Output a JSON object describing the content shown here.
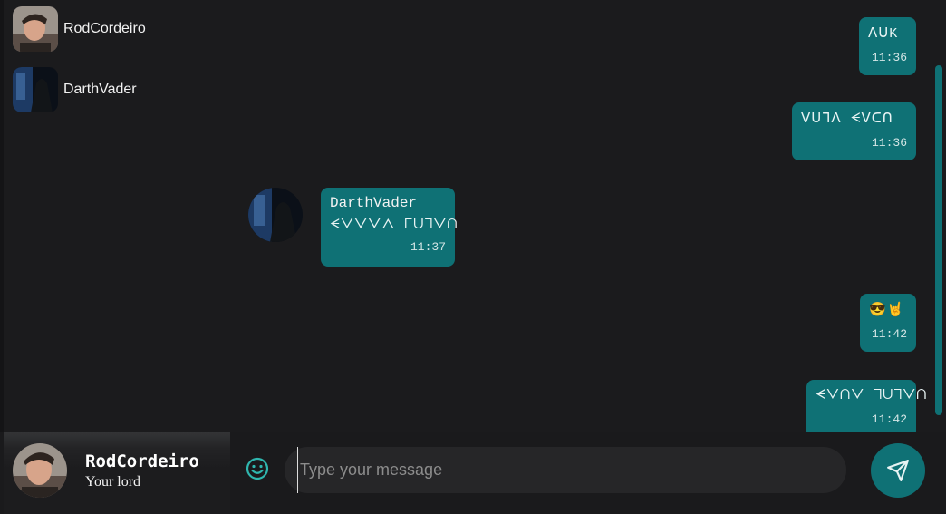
{
  "contacts": [
    {
      "name": "RodCordeiro"
    },
    {
      "name": "DarthVader"
    }
  ],
  "messages": [
    {
      "text": "ᐱᑌK",
      "time": "11:36",
      "outgoing": true
    },
    {
      "text": "ᐯᑌᒣᐱ ᗕᐯᑕᑎ",
      "time": "11:36",
      "outgoing": true
    },
    {
      "sender": "DarthVader",
      "text": "ᗕᐯᐯᐯᐱ ᒥᑌᒣᐯᑎ",
      "time": "11:37",
      "outgoing": false
    },
    {
      "text": "😎🤘",
      "time": "11:42",
      "outgoing": true
    },
    {
      "text": "ᗕᐯᑎᐯ ᒣᑌᒣᐯᑎ",
      "time": "11:42",
      "outgoing": true
    }
  ],
  "profile": {
    "name": "RodCordeiro",
    "status": "Your lord"
  },
  "composer": {
    "placeholder": "Type your message"
  },
  "colors": {
    "accent": "#0f7175",
    "background": "#1b1b1d"
  },
  "icons": {
    "emoji": "smiley-face-icon",
    "send": "paper-plane-icon"
  }
}
